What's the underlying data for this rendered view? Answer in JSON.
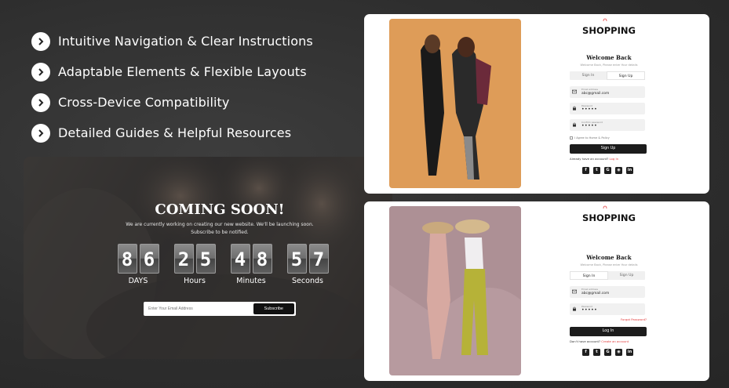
{
  "features": [
    {
      "label": "Intuitive Navigation & Clear Instructions",
      "icon": "chevron-right-icon"
    },
    {
      "label": "Adaptable Elements & Flexible Layouts",
      "icon": "chevron-right-icon"
    },
    {
      "label": "Cross-Device Compatibility",
      "icon": "chevron-right-icon"
    },
    {
      "label": "Detailed Guides & Helpful Resources",
      "icon": "chevron-right-icon"
    }
  ],
  "coming_soon": {
    "title": "COMING SOON!",
    "description": "We are currently working on creating our new website. We'll be launching soon. Subscribe to be notified.",
    "timer": [
      {
        "digits": [
          "8",
          "6"
        ],
        "label": "DAYS"
      },
      {
        "digits": [
          "2",
          "5"
        ],
        "label": "Hours"
      },
      {
        "digits": [
          "4",
          "8"
        ],
        "label": "Minutes"
      },
      {
        "digits": [
          "5",
          "7"
        ],
        "label": "Seconds"
      }
    ],
    "email_placeholder": "Enter Your Email Address",
    "subscribe_label": "Subscribe"
  },
  "signup_card": {
    "brand": "SHOPPING",
    "title": "Welcome Back",
    "subtitle": "Welcome Back, Please enter Your details",
    "tab_signin": "Sign In",
    "tab_signup": "Sign Up",
    "email_label": "Email address",
    "email_value": "abc@gmail.com",
    "password_label": "Password",
    "password_value": "•••••",
    "confirm_label": "Confirm password",
    "confirm_value": "•••••",
    "agree_text": "I Agree to Home & Policy",
    "button_label": "Sign Up",
    "footer_text": "Already have an account?",
    "footer_link": "Log In"
  },
  "login_card": {
    "brand": "SHOPPING",
    "title": "Welcome Back",
    "subtitle": "Welcome Back, Please enter Your details",
    "tab_signin": "Sign In",
    "tab_signup": "Sign Up",
    "email_label": "Email address",
    "email_value": "abc@gmail.com",
    "password_label": "Password",
    "password_value": "•••••",
    "forgot_label": "Forgot Password?",
    "button_label": "Log In",
    "footer_text": "Don't have account?",
    "footer_link": "Create an account"
  },
  "social_icons": [
    "f",
    "t",
    "G",
    "◉",
    "in"
  ],
  "colors": {
    "accent": "#e23b3b",
    "dark": "#1c1c1c",
    "background": "#2e2e2e"
  }
}
